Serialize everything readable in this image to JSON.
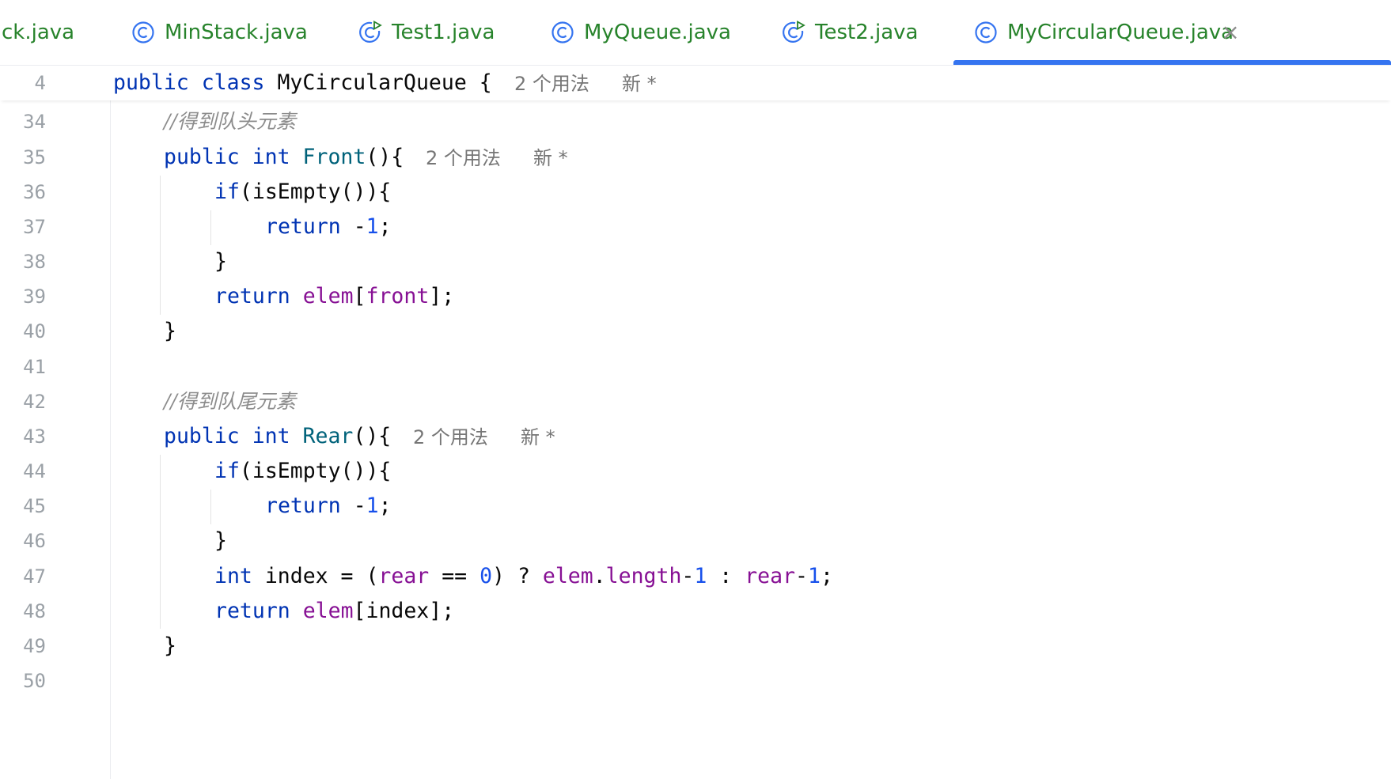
{
  "tabs": [
    {
      "label": "ck.java",
      "icon": "class-icon"
    },
    {
      "label": "MinStack.java",
      "icon": "class-icon"
    },
    {
      "label": "Test1.java",
      "icon": "runnable-class-icon"
    },
    {
      "label": "MyQueue.java",
      "icon": "class-icon"
    },
    {
      "label": "Test2.java",
      "icon": "runnable-class-icon"
    },
    {
      "label": "MyCircularQueue.java",
      "icon": "class-icon",
      "active": true
    }
  ],
  "close_glyph": "×",
  "header": {
    "line_no": "4",
    "kw1": "public",
    "kw2": "class",
    "name": "MyCircularQueue",
    "brace": "{",
    "usage": "2 个用法",
    "new": "新 *"
  },
  "lines": {
    "l34": {
      "no": "34",
      "comment": "//得到队头元素"
    },
    "l35": {
      "no": "35",
      "kw1": "public",
      "kw2": "int",
      "fn": "Front",
      "rest": "(){",
      "usage": "2 个用法",
      "new": "新 *"
    },
    "l36": {
      "no": "36",
      "kw": "if",
      "rest": "(isEmpty()){"
    },
    "l37": {
      "no": "37",
      "kw": "return",
      "op": " -",
      "num": "1",
      "rest": ";"
    },
    "l38": {
      "no": "38",
      "rest": "}"
    },
    "l39": {
      "no": "39",
      "kw": "return",
      "f1": "elem",
      "p1": "[",
      "f2": "front",
      "p2": "];"
    },
    "l40": {
      "no": "40",
      "rest": "}"
    },
    "l41": {
      "no": "41"
    },
    "l42": {
      "no": "42",
      "comment": "//得到队尾元素"
    },
    "l43": {
      "no": "43",
      "kw1": "public",
      "kw2": "int",
      "fn": "Rear",
      "rest": "(){",
      "usage": "2 个用法",
      "new": "新 *"
    },
    "l44": {
      "no": "44",
      "kw": "if",
      "rest": "(isEmpty()){"
    },
    "l45": {
      "no": "45",
      "kw": "return",
      "op": " -",
      "num": "1",
      "rest": ";"
    },
    "l46": {
      "no": "46",
      "rest": "}"
    },
    "l47": {
      "no": "47",
      "kw": "int",
      "t1": " index = (",
      "f1": "rear",
      "t2": " == ",
      "n1": "0",
      "t3": ") ? ",
      "f2": "elem",
      "t4": ".",
      "f3": "length",
      "t5": "-",
      "n2": "1",
      "t6": " : ",
      "f4": "rear",
      "t7": "-",
      "n3": "1",
      "t8": ";"
    },
    "l48": {
      "no": "48",
      "kw": "return",
      "f1": "elem",
      "rest": "[index];"
    },
    "l49": {
      "no": "49",
      "rest": "}"
    },
    "l50": {
      "no": "50"
    }
  },
  "colors": {
    "tab_text": "#27832b",
    "active_underline": "#3574f0",
    "keyword": "#0033b3",
    "method": "#00627a",
    "field": "#871094",
    "number": "#1750eb",
    "comment": "#8c8c8c",
    "line_number": "#9aa0a6"
  }
}
